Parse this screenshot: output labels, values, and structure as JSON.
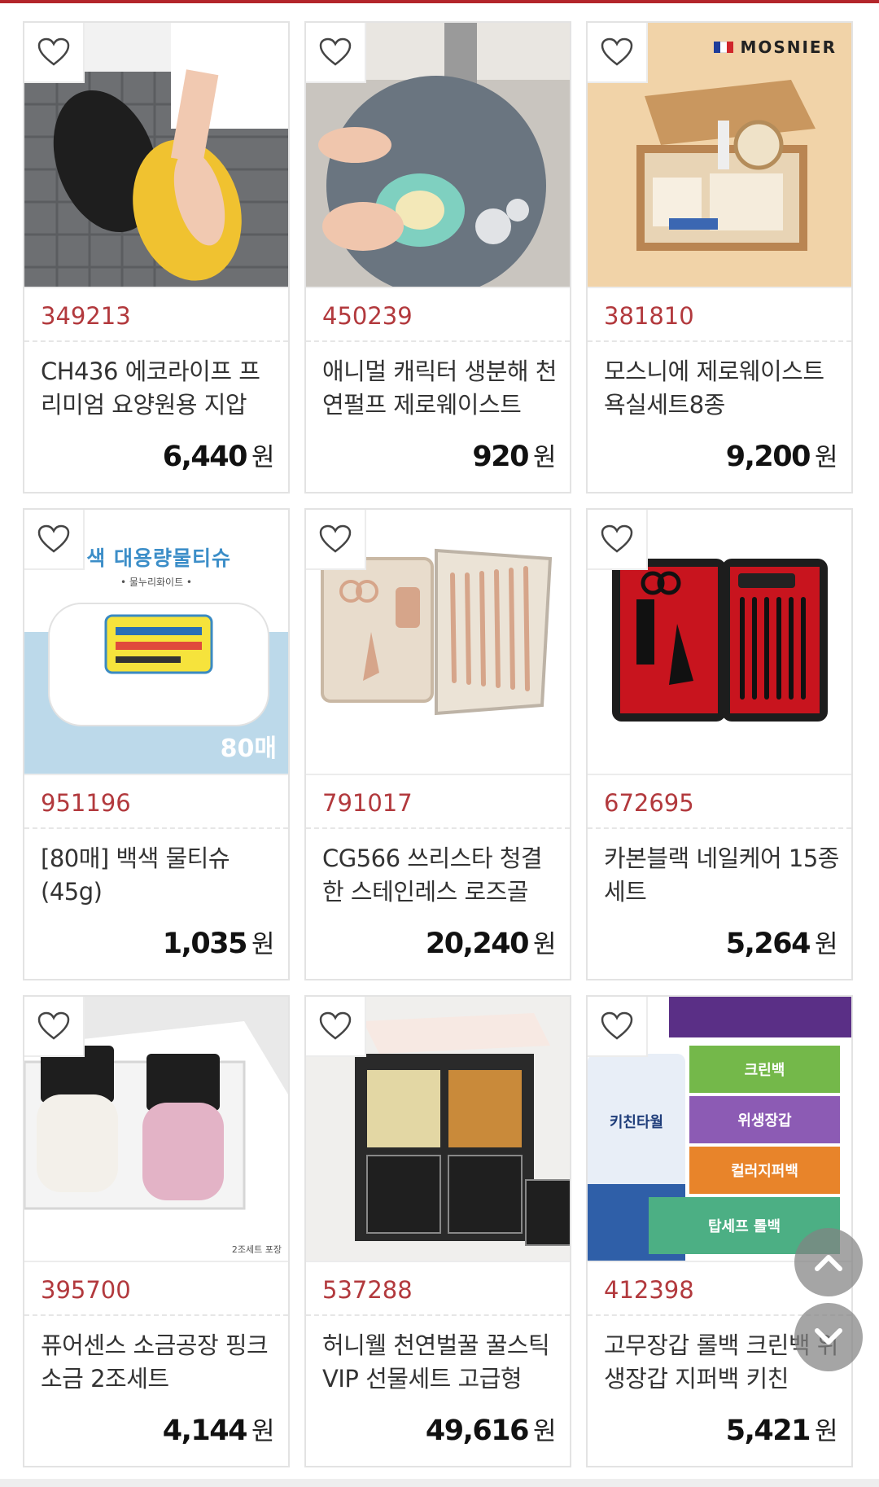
{
  "products": [
    {
      "code": "349213",
      "name": "CH436 에코라이프 프리미엄 요양원용 지압",
      "price": "6,440",
      "currency": "원",
      "image": "slippers"
    },
    {
      "code": "450239",
      "name": "애니멀 캐릭터 생분해 천연펄프 제로웨이스트",
      "price": "920",
      "currency": "원",
      "image": "sponge"
    },
    {
      "code": "381810",
      "name": "모스니에 제로웨이스트 욕실세트8종",
      "price": "9,200",
      "currency": "원",
      "image": "bath-set",
      "brand": "MOSNIER"
    },
    {
      "code": "951196",
      "name": "[80매] 백색 물티슈 (45g)",
      "price": "1,035",
      "currency": "원",
      "image": "wet-tissue",
      "img_title": "백색 대용량물티슈",
      "img_sub": "• 물누리화이트 •",
      "img_count": "80매"
    },
    {
      "code": "791017",
      "name": "CG566 쓰리스타 청결한 스테인레스 로즈골",
      "price": "20,240",
      "currency": "원",
      "image": "nail-kit-rose"
    },
    {
      "code": "672695",
      "name": "카본블랙 네일케어 15종세트",
      "price": "5,264",
      "currency": "원",
      "image": "nail-kit-black"
    },
    {
      "code": "395700",
      "name": "퓨어센스 소금공장 핑크소금 2조세트",
      "price": "4,144",
      "currency": "원",
      "image": "salt",
      "img_note": "2조세트 포장"
    },
    {
      "code": "537288",
      "name": "허니웰 천연벌꿀 꿀스틱 VIP 선물세트 고급형",
      "price": "49,616",
      "currency": "원",
      "image": "honey"
    },
    {
      "code": "412398",
      "name": "고무장갑 롤백 크린백 위생장갑 지퍼백 키친",
      "price": "5,421",
      "currency": "원",
      "image": "kitchen",
      "img_labels": [
        "크린백",
        "위생장갑",
        "컬러지퍼백",
        "탑세프 롤백",
        "키친타월"
      ]
    }
  ],
  "colors": {
    "accent": "#b2393d",
    "border": "#e3e3e3",
    "price": "#111111"
  },
  "icons": {
    "favorite": "heart-outline-icon",
    "scroll_up": "chevron-up-icon",
    "scroll_down": "chevron-down-icon"
  }
}
